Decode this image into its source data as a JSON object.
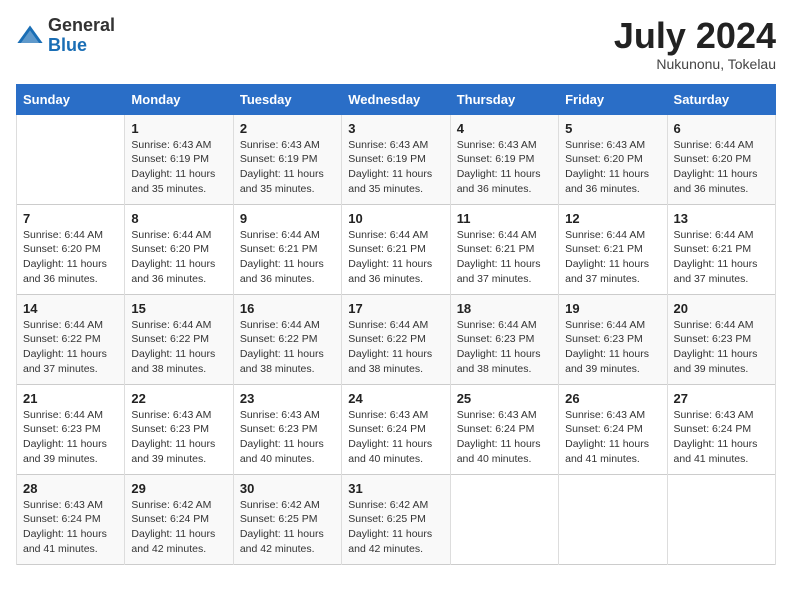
{
  "header": {
    "logo": {
      "general": "General",
      "blue": "Blue"
    },
    "title": "July 2024",
    "location": "Nukunonu, Tokelau"
  },
  "days_of_week": [
    "Sunday",
    "Monday",
    "Tuesday",
    "Wednesday",
    "Thursday",
    "Friday",
    "Saturday"
  ],
  "weeks": [
    [
      {
        "day": "",
        "detail": ""
      },
      {
        "day": "1",
        "detail": "Sunrise: 6:43 AM\nSunset: 6:19 PM\nDaylight: 11 hours\nand 35 minutes."
      },
      {
        "day": "2",
        "detail": "Sunrise: 6:43 AM\nSunset: 6:19 PM\nDaylight: 11 hours\nand 35 minutes."
      },
      {
        "day": "3",
        "detail": "Sunrise: 6:43 AM\nSunset: 6:19 PM\nDaylight: 11 hours\nand 35 minutes."
      },
      {
        "day": "4",
        "detail": "Sunrise: 6:43 AM\nSunset: 6:19 PM\nDaylight: 11 hours\nand 36 minutes."
      },
      {
        "day": "5",
        "detail": "Sunrise: 6:43 AM\nSunset: 6:20 PM\nDaylight: 11 hours\nand 36 minutes."
      },
      {
        "day": "6",
        "detail": "Sunrise: 6:44 AM\nSunset: 6:20 PM\nDaylight: 11 hours\nand 36 minutes."
      }
    ],
    [
      {
        "day": "7",
        "detail": "Sunrise: 6:44 AM\nSunset: 6:20 PM\nDaylight: 11 hours\nand 36 minutes."
      },
      {
        "day": "8",
        "detail": "Sunrise: 6:44 AM\nSunset: 6:20 PM\nDaylight: 11 hours\nand 36 minutes."
      },
      {
        "day": "9",
        "detail": "Sunrise: 6:44 AM\nSunset: 6:21 PM\nDaylight: 11 hours\nand 36 minutes."
      },
      {
        "day": "10",
        "detail": "Sunrise: 6:44 AM\nSunset: 6:21 PM\nDaylight: 11 hours\nand 36 minutes."
      },
      {
        "day": "11",
        "detail": "Sunrise: 6:44 AM\nSunset: 6:21 PM\nDaylight: 11 hours\nand 37 minutes."
      },
      {
        "day": "12",
        "detail": "Sunrise: 6:44 AM\nSunset: 6:21 PM\nDaylight: 11 hours\nand 37 minutes."
      },
      {
        "day": "13",
        "detail": "Sunrise: 6:44 AM\nSunset: 6:21 PM\nDaylight: 11 hours\nand 37 minutes."
      }
    ],
    [
      {
        "day": "14",
        "detail": "Sunrise: 6:44 AM\nSunset: 6:22 PM\nDaylight: 11 hours\nand 37 minutes."
      },
      {
        "day": "15",
        "detail": "Sunrise: 6:44 AM\nSunset: 6:22 PM\nDaylight: 11 hours\nand 38 minutes."
      },
      {
        "day": "16",
        "detail": "Sunrise: 6:44 AM\nSunset: 6:22 PM\nDaylight: 11 hours\nand 38 minutes."
      },
      {
        "day": "17",
        "detail": "Sunrise: 6:44 AM\nSunset: 6:22 PM\nDaylight: 11 hours\nand 38 minutes."
      },
      {
        "day": "18",
        "detail": "Sunrise: 6:44 AM\nSunset: 6:23 PM\nDaylight: 11 hours\nand 38 minutes."
      },
      {
        "day": "19",
        "detail": "Sunrise: 6:44 AM\nSunset: 6:23 PM\nDaylight: 11 hours\nand 39 minutes."
      },
      {
        "day": "20",
        "detail": "Sunrise: 6:44 AM\nSunset: 6:23 PM\nDaylight: 11 hours\nand 39 minutes."
      }
    ],
    [
      {
        "day": "21",
        "detail": "Sunrise: 6:44 AM\nSunset: 6:23 PM\nDaylight: 11 hours\nand 39 minutes."
      },
      {
        "day": "22",
        "detail": "Sunrise: 6:43 AM\nSunset: 6:23 PM\nDaylight: 11 hours\nand 39 minutes."
      },
      {
        "day": "23",
        "detail": "Sunrise: 6:43 AM\nSunset: 6:23 PM\nDaylight: 11 hours\nand 40 minutes."
      },
      {
        "day": "24",
        "detail": "Sunrise: 6:43 AM\nSunset: 6:24 PM\nDaylight: 11 hours\nand 40 minutes."
      },
      {
        "day": "25",
        "detail": "Sunrise: 6:43 AM\nSunset: 6:24 PM\nDaylight: 11 hours\nand 40 minutes."
      },
      {
        "day": "26",
        "detail": "Sunrise: 6:43 AM\nSunset: 6:24 PM\nDaylight: 11 hours\nand 41 minutes."
      },
      {
        "day": "27",
        "detail": "Sunrise: 6:43 AM\nSunset: 6:24 PM\nDaylight: 11 hours\nand 41 minutes."
      }
    ],
    [
      {
        "day": "28",
        "detail": "Sunrise: 6:43 AM\nSunset: 6:24 PM\nDaylight: 11 hours\nand 41 minutes."
      },
      {
        "day": "29",
        "detail": "Sunrise: 6:42 AM\nSunset: 6:24 PM\nDaylight: 11 hours\nand 42 minutes."
      },
      {
        "day": "30",
        "detail": "Sunrise: 6:42 AM\nSunset: 6:25 PM\nDaylight: 11 hours\nand 42 minutes."
      },
      {
        "day": "31",
        "detail": "Sunrise: 6:42 AM\nSunset: 6:25 PM\nDaylight: 11 hours\nand 42 minutes."
      },
      {
        "day": "",
        "detail": ""
      },
      {
        "day": "",
        "detail": ""
      },
      {
        "day": "",
        "detail": ""
      }
    ]
  ]
}
